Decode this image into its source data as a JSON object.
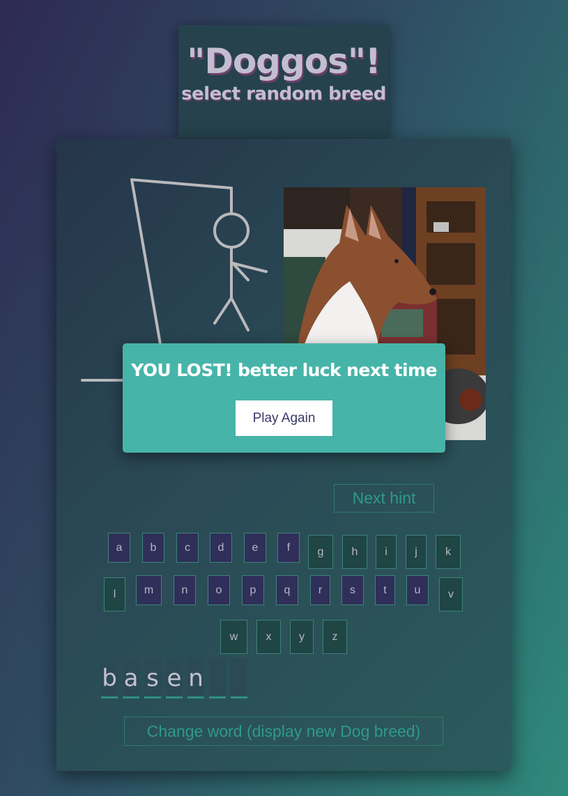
{
  "header": {
    "title": "\"Doggos\"!",
    "subtitle": "select random breed"
  },
  "modal": {
    "message": "YOU LOST! better luck next time",
    "play_again_label": "Play Again"
  },
  "controls": {
    "next_hint_label": "Next hint",
    "change_word_label": "Change word (display new Dog breed)"
  },
  "keyboard": {
    "row1": [
      "a",
      "b",
      "c",
      "d",
      "e",
      "f",
      "g",
      "h",
      "i",
      "j",
      "k"
    ],
    "row2": [
      "l",
      "m",
      "n",
      "o",
      "p",
      "q",
      "r",
      "s",
      "t",
      "u",
      "v"
    ],
    "row3": [
      "w",
      "x",
      "y",
      "z"
    ],
    "used_letters": [
      "a",
      "b",
      "c",
      "d",
      "e",
      "f",
      "m",
      "n",
      "o",
      "p",
      "q",
      "r",
      "s",
      "t",
      "u"
    ]
  },
  "word": {
    "slots": [
      "b",
      "a",
      "s",
      "e",
      "n",
      "",
      ""
    ]
  },
  "image": {
    "subject": "basenji-dog-photo"
  },
  "colors": {
    "modal_bg": "#47b4a9",
    "accent": "#2f9a87",
    "title_shadow": "#6d3f6a"
  }
}
